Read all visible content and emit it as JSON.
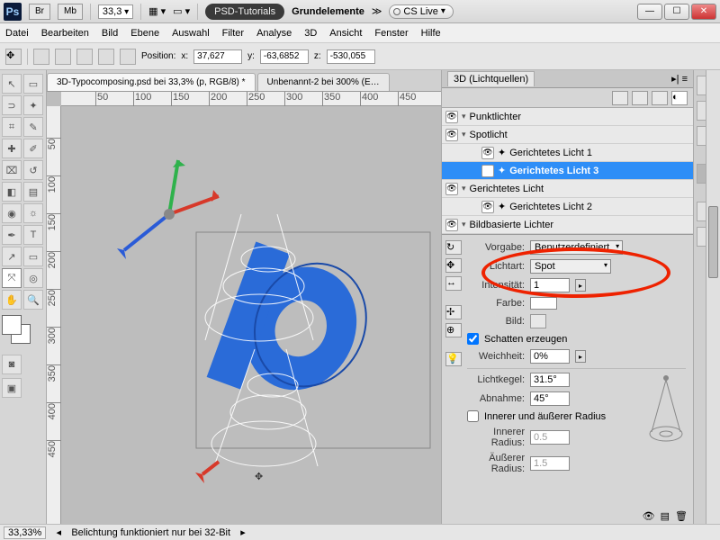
{
  "titlebar": {
    "app": "Ps",
    "btn_br": "Br",
    "btn_mb": "Mb",
    "zoom": "33,3",
    "doc_group": "PSD-Tutorials",
    "doc_name": "Grundelemente",
    "cslive": "CS Live"
  },
  "menu": [
    "Datei",
    "Bearbeiten",
    "Bild",
    "Ebene",
    "Auswahl",
    "Filter",
    "Analyse",
    "3D",
    "Ansicht",
    "Fenster",
    "Hilfe"
  ],
  "options": {
    "position_label": "Position:",
    "x_label": "x:",
    "x_val": "37,627",
    "y_label": "y:",
    "y_val": "-63,6852",
    "z_label": "z:",
    "z_val": "-530,055"
  },
  "doctabs": {
    "tab1": "3D-Typocomposing.psd bei 33,3% (p, RGB/8) *",
    "tab2": "Unbenannt-2 bei 300% (E…"
  },
  "ruler_h": [
    50,
    100,
    150,
    200,
    250,
    300,
    350,
    400,
    450
  ],
  "ruler_v": [
    50,
    100,
    150,
    200,
    250,
    300,
    350,
    400,
    450
  ],
  "panel": {
    "title": "3D (Lichtquellen)",
    "groups": {
      "punkt": "Punktlichter",
      "spot": "Spotlicht",
      "g1": "Gerichtetes Licht 1",
      "g3": "Gerichtetes Licht 3",
      "gericht": "Gerichtetes Licht",
      "g2": "Gerichtetes Licht 2",
      "bild": "Bildbasierte Lichter"
    },
    "props": {
      "vorgabe_l": "Vorgabe:",
      "vorgabe_v": "Benutzerdefiniert",
      "lichtart_l": "Lichtart:",
      "lichtart_v": "Spot",
      "intensitaet_l": "Intensität:",
      "intensitaet_v": "1",
      "farbe_l": "Farbe:",
      "bild_l": "Bild:",
      "schatten": "Schatten erzeugen",
      "weich_l": "Weichheit:",
      "weich_v": "0%",
      "kegel_l": "Lichtkegel:",
      "kegel_v": "31.5°",
      "abnahme_l": "Abnahme:",
      "abnahme_v": "45°",
      "radius_cb": "Innerer und äußerer Radius",
      "inner_l": "Innerer Radius:",
      "inner_v": "0.5",
      "outer_l": "Äußerer Radius:",
      "outer_v": "1.5"
    }
  },
  "status": {
    "zoom": "33,33%",
    "msg": "Belichtung funktioniert nur bei 32-Bit"
  }
}
